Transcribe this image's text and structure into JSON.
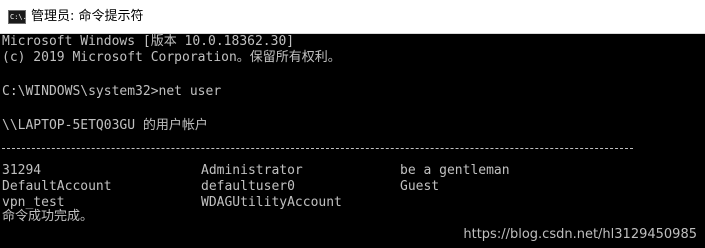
{
  "window": {
    "title": "管理员: 命令提示符",
    "icon": "cmd-console-icon",
    "icon_text": "C:\\."
  },
  "console": {
    "header_line1": "Microsoft Windows [版本 10.0.18362.30]",
    "header_line2": "(c) 2019 Microsoft Corporation。保留所有权利。",
    "prompt": "C:\\WINDOWS\\system32>net user",
    "accounts_heading": "\\\\LAPTOP-5ETQ03GU 的用户帐户",
    "separator": "-------------------------------------------------------------------------------",
    "users": [
      [
        "31294",
        "Administrator",
        "be a gentleman"
      ],
      [
        "DefaultAccount",
        "defaultuser0",
        "Guest"
      ],
      [
        "vpn_test",
        "WDAGUtilityAccount",
        ""
      ]
    ],
    "completion": "命令成功完成。",
    "text_color": "#c0c0c0",
    "background_color": "#000000"
  },
  "watermark": "https://blog.csdn.net/hl3129450985"
}
